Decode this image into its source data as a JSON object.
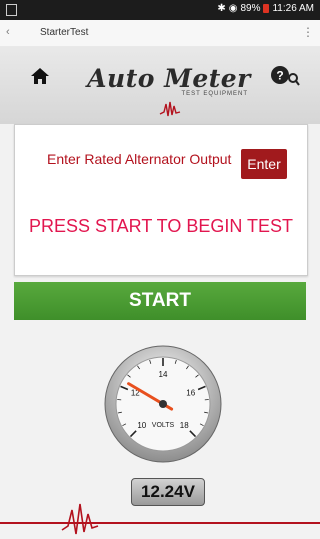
{
  "statusbar": {
    "battery_text": "89%",
    "time": "11:26 AM"
  },
  "appbar": {
    "title": "StarterTest"
  },
  "header": {
    "logo": "Auto Meter",
    "logo_sub": "TEST EQUIPMENT"
  },
  "card": {
    "label": "Enter Rated Alternator Output",
    "enter_label": "Enter",
    "prompt": "PRESS START TO BEGIN TEST"
  },
  "start_label": "START",
  "gauge": {
    "ticks": [
      "10",
      "12",
      "14",
      "16",
      "18"
    ],
    "unit": "VOLTS",
    "reading": 12.24
  },
  "readout": "12.24V"
}
